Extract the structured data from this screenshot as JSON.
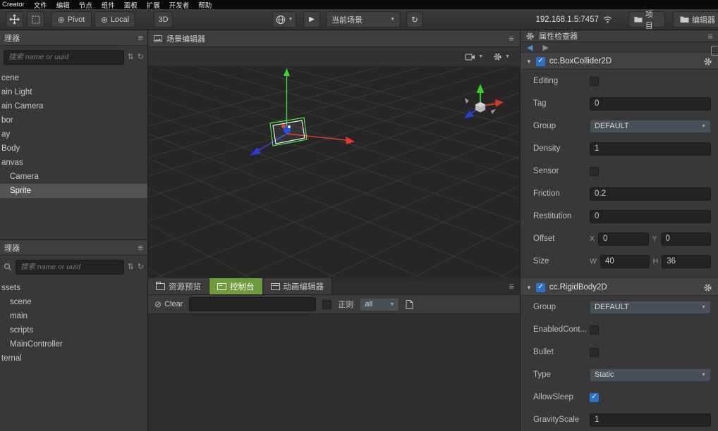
{
  "menu_bar": {
    "items": [
      "Creator",
      "文件",
      "编辑",
      "节点",
      "组件",
      "面板",
      "扩展",
      "开发者",
      "帮助"
    ]
  },
  "toolbar": {
    "pivot_label": "Pivot",
    "local_label": "Local",
    "mode_3d_label": "3D",
    "scene_select_value": "当前场景",
    "address": "192.168.1.5:7457",
    "project_button": "项目",
    "editor_button": "编辑器"
  },
  "hierarchy": {
    "title": "理器",
    "search_placeholder": "搜索 name or uuid",
    "items": [
      {
        "label": "cene",
        "indent": 0
      },
      {
        "label": "ain Light",
        "indent": 0
      },
      {
        "label": "ain Camera",
        "indent": 0
      },
      {
        "label": "bor",
        "indent": 0
      },
      {
        "label": "ay",
        "indent": 0
      },
      {
        "label": "Body",
        "indent": 0
      },
      {
        "label": "anvas",
        "indent": 0
      },
      {
        "label": "Camera",
        "indent": 1
      },
      {
        "label": "Sprite",
        "indent": 1,
        "selected": true
      }
    ]
  },
  "assets": {
    "title": "理器",
    "search_placeholder": "搜索 name or uuid",
    "items": [
      {
        "label": "ssets",
        "indent": 0
      },
      {
        "label": "scene",
        "indent": 1
      },
      {
        "label": "main",
        "indent": 1
      },
      {
        "label": "scripts",
        "indent": 1
      },
      {
        "label": "MainController",
        "indent": 1
      },
      {
        "label": "ternal",
        "indent": 0
      }
    ]
  },
  "scene": {
    "title": "场景编辑器"
  },
  "console": {
    "tabs": [
      {
        "label": "资源预览",
        "active": false
      },
      {
        "label": "控制台",
        "active": true
      },
      {
        "label": "动画编辑器",
        "active": false
      }
    ],
    "clear_label": "Clear",
    "regex_label": "正则",
    "filter_value": "all"
  },
  "inspector": {
    "title": "属性检查器",
    "components": [
      {
        "name": "cc.BoxCollider2D",
        "enabled": true,
        "props": [
          {
            "label": "Editing",
            "type": "checkbox",
            "checked": false
          },
          {
            "label": "Tag",
            "type": "input",
            "value": "0"
          },
          {
            "label": "Group",
            "type": "select",
            "value": "DEFAULT"
          },
          {
            "label": "Density",
            "type": "input",
            "value": "1"
          },
          {
            "label": "Sensor",
            "type": "checkbox",
            "checked": false
          },
          {
            "label": "Friction",
            "type": "input",
            "value": "0.2"
          },
          {
            "label": "Restitution",
            "type": "input",
            "value": "0"
          },
          {
            "label": "Offset",
            "type": "vec2",
            "fields": [
              {
                "k": "X",
                "v": "0"
              },
              {
                "k": "Y",
                "v": "0"
              }
            ]
          },
          {
            "label": "Size",
            "type": "vec2",
            "fields": [
              {
                "k": "W",
                "v": "40"
              },
              {
                "k": "H",
                "v": "36"
              }
            ]
          }
        ]
      },
      {
        "name": "cc.RigidBody2D",
        "enabled": true,
        "props": [
          {
            "label": "Group",
            "type": "select",
            "value": "DEFAULT"
          },
          {
            "label": "EnabledCont...",
            "type": "checkbox",
            "checked": false
          },
          {
            "label": "Bullet",
            "type": "checkbox",
            "checked": false
          },
          {
            "label": "Type",
            "type": "select",
            "value": "Static"
          },
          {
            "label": "AllowSleep",
            "type": "checkbox",
            "checked": true
          },
          {
            "label": "GravityScale",
            "type": "input",
            "value": "1"
          }
        ]
      }
    ]
  },
  "colors": {
    "active_tab_green": "#6f9a3d",
    "checkbox_blue": "#2d72c8",
    "axis_red": "#d23b2c",
    "axis_green": "#35cf35",
    "axis_blue": "#2c3ed0"
  }
}
